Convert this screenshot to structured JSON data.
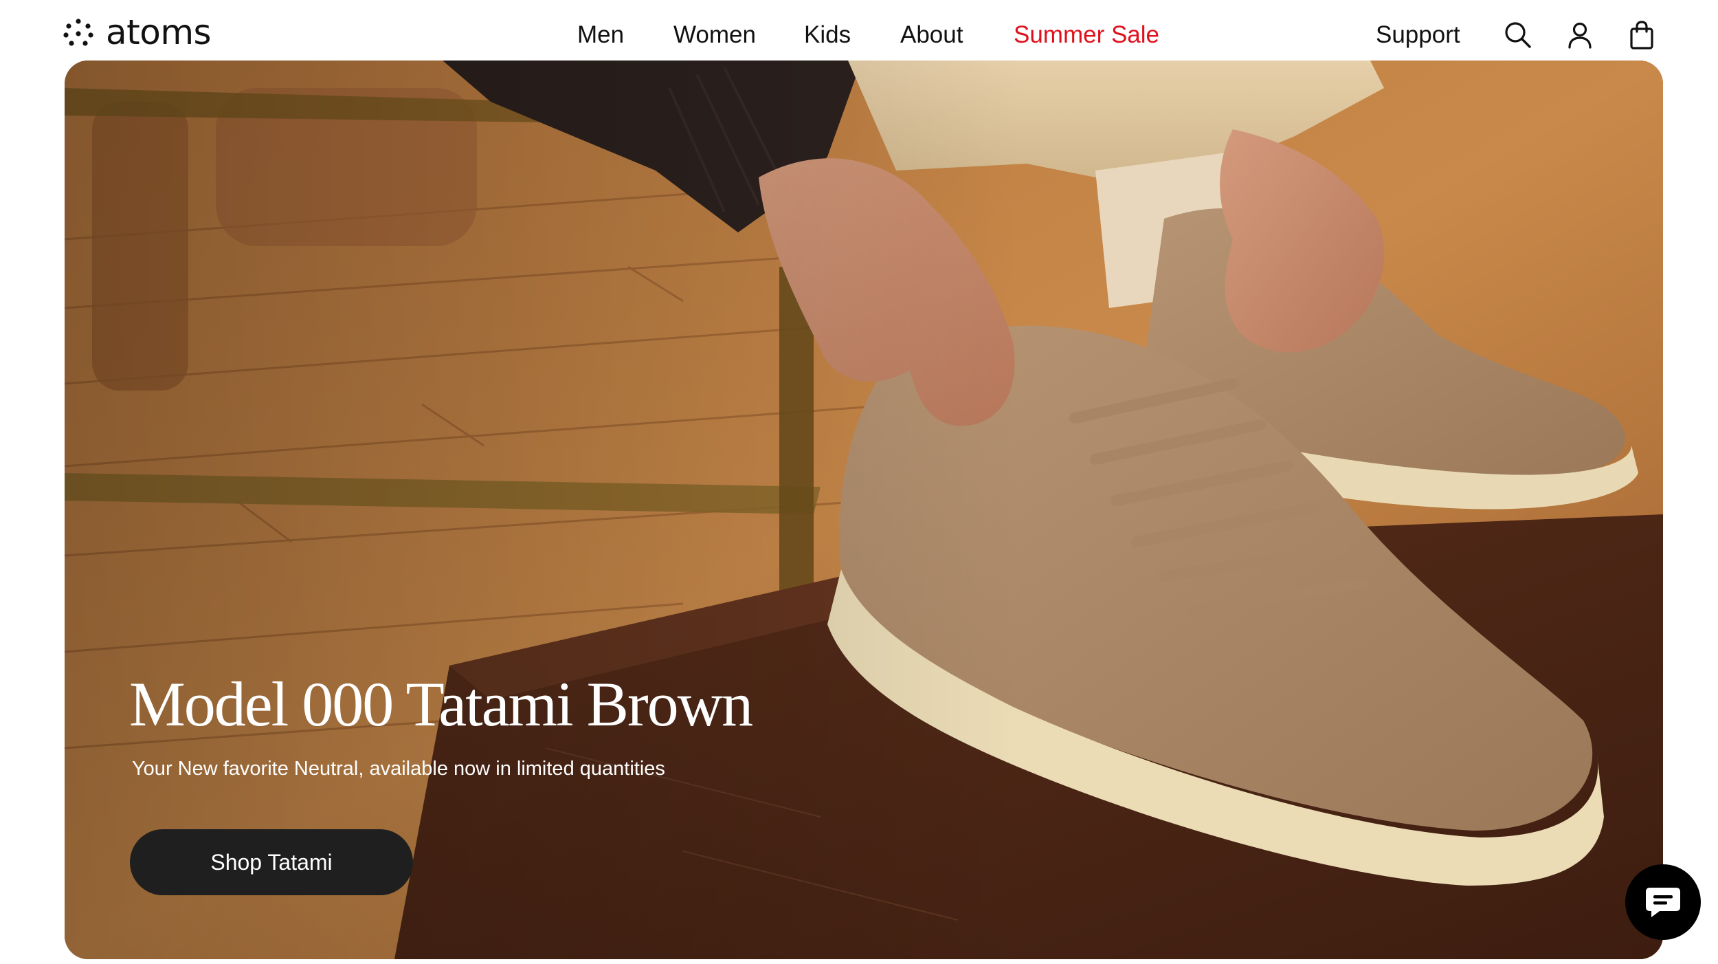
{
  "header": {
    "logo_text": "atoms",
    "nav": [
      {
        "label": "Men"
      },
      {
        "label": "Women"
      },
      {
        "label": "Kids"
      },
      {
        "label": "About"
      },
      {
        "label": "Summer Sale",
        "color": "#e0101b"
      }
    ],
    "support_label": "Support",
    "icons": [
      "search-icon",
      "account-icon",
      "shopping-bag-icon"
    ]
  },
  "hero": {
    "title": "Model 000 Tatami Brown",
    "subtitle": "Your New favorite Neutral, available now in limited quantities",
    "cta_label": "Shop Tatami",
    "cta_color": "#1f1f1f"
  },
  "chat": {
    "icon": "chat-bubble-icon",
    "color": "#000000"
  }
}
